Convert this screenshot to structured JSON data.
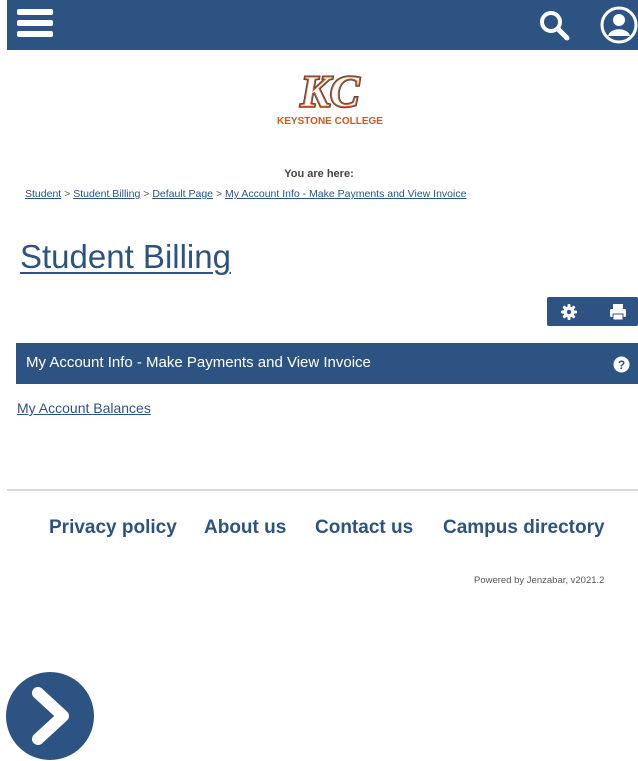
{
  "header": {
    "menu_icon": "hamburger-icon",
    "search_icon": "search-icon",
    "user_icon": "user-account-icon",
    "bar_color": "#2d5383"
  },
  "logo": {
    "letters": "KC",
    "text": "KEYSTONE COLLEGE",
    "accent_color": "#d9541e"
  },
  "breadcrumb": {
    "heading": "You are here:",
    "items": [
      "Student",
      "Student Billing",
      "Default Page",
      "My Account Info - Make Payments and View Invoice"
    ],
    "separator": ">"
  },
  "page": {
    "title": "Student Billing"
  },
  "tools": {
    "settings_icon": "gear-icon",
    "print_icon": "printer-icon"
  },
  "portlet": {
    "title": "My Account Info - Make Payments and View Invoice",
    "help_icon": "help-icon",
    "link": "My Account Balances"
  },
  "footer": {
    "links": [
      "Privacy policy",
      "About us",
      "Contact us",
      "Campus directory"
    ],
    "powered": "Powered by Jenzabar, v2021.2"
  },
  "fab": {
    "icon": "chevron-right-icon"
  }
}
